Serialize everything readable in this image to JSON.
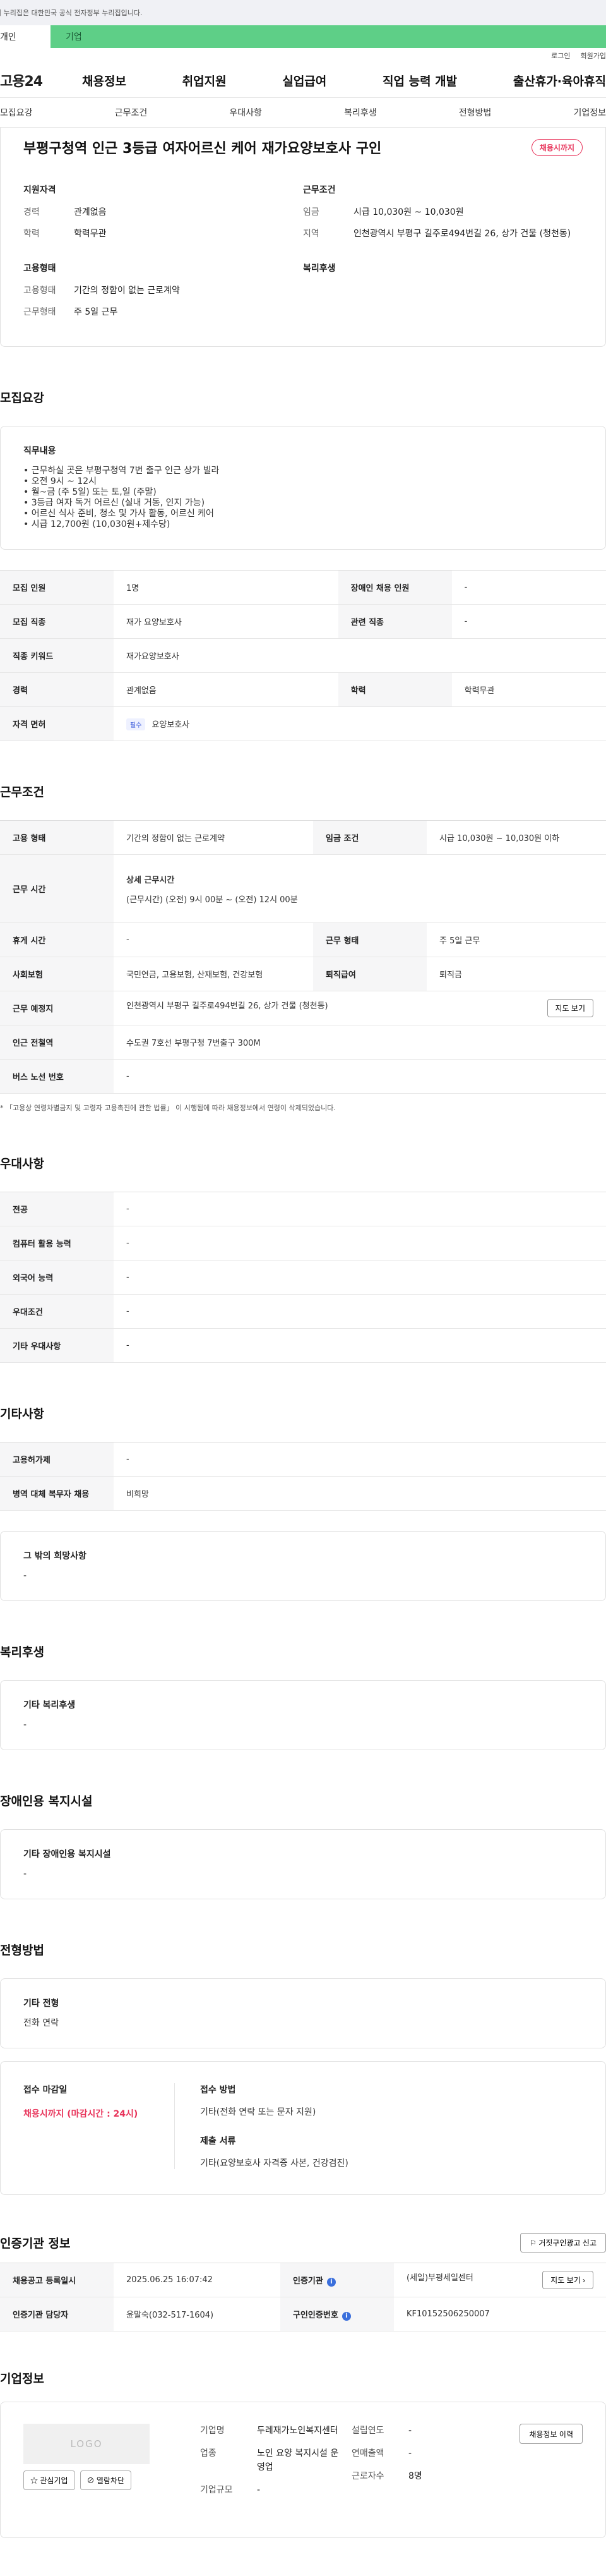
{
  "gov_banner": "이 누리집은 대한민국 공식 전자정부 누리집입니다.",
  "user_tabs": {
    "person": "개인",
    "business": "기업"
  },
  "util_links": [
    "로그인",
    "회원가입"
  ],
  "logo": "고용24",
  "gnb": [
    "채용정보",
    "취업지원",
    "실업급여",
    "직업 능력 개발",
    "출산휴가·육아휴직"
  ],
  "anchor_tabs": [
    "모집요강",
    "근무조건",
    "우대사항",
    "복리후생",
    "전형방법",
    "기업정보"
  ],
  "hero": {
    "title": "부평구청역 인근 3등급 여자어르신 케어 재가요양보호사 구인",
    "status": "채용시까지",
    "qual_title": "지원자격",
    "cond_title": "근무조건",
    "emp_title": "고용형태",
    "welfare_title": "복리후생",
    "qual": [
      {
        "k": "경력",
        "v": "관계없음"
      },
      {
        "k": "학력",
        "v": "학력무관"
      }
    ],
    "cond": [
      {
        "k": "임금",
        "v": "시급 10,030원 ~ 10,030원"
      },
      {
        "k": "지역",
        "v": "인천광역시 부평구 길주로494번길 26, 상가 건물 (청천동)"
      }
    ],
    "emp": [
      {
        "k": "고용형태",
        "v": "기간의 정함이 없는 근로계약"
      },
      {
        "k": "근무형태",
        "v": "주 5일 근무"
      }
    ]
  },
  "recruit": {
    "title": "모집요강",
    "duty_title": "직무내용",
    "duty_text": "• 근무하실 곳은 부평구청역 7번 출구 인근 상가 빌라\n• 오전 9시 ~ 12시\n• 월~금 (주 5일) 또는 토,일 (주말)\n• 3등급 여자 독거 어르신 (실내 거동, 인지 가능)\n• 어르신 식사 준비, 청소 및 가사 활동, 어르신 케어\n• 시급 12,700원 (10,030원+제수당)",
    "rows": [
      {
        "k1": "모집 인원",
        "v1": "1명",
        "k2": "장애인 채용 인원",
        "v2": "-"
      },
      {
        "k1": "모집 직종",
        "v1": "재가 요양보호사",
        "k2": "관련 직종",
        "v2": "-"
      },
      {
        "k1": "직종 키워드",
        "v1": "재가요양보호사"
      },
      {
        "k1": "경력",
        "v1": "관계없음",
        "k2": "학력",
        "v2": "학력무관"
      }
    ],
    "license_label": "자격 면허",
    "license_tag": "필수",
    "license_value": "요양보호사"
  },
  "work": {
    "title": "근무조건",
    "emp_type_k": "고용 형태",
    "emp_type_v": "기간의 정함이 없는 근로계약",
    "wage_k": "임금 조건",
    "wage_v": "시급 10,030원 ~ 10,030원 이하",
    "time_k": "근무 시간",
    "time_h": "상세 근무시간",
    "time_v": "(근무시간) (오전) 9시 00분 ~ (오전) 12시 00분",
    "rest_k": "휴게 시간",
    "rest_v": "-",
    "form_k": "근무 형태",
    "form_v": "주 5일 근무",
    "ins_k": "사회보험",
    "ins_v": "국민연금, 고용보험, 산재보험, 건강보험",
    "sev_k": "퇴직급여",
    "sev_v": "퇴직금",
    "place_k": "근무 예정지",
    "place_v": "인천광역시 부평구 길주로494번길 26, 상가 건물 (청천동)",
    "map_btn": "지도 보기",
    "station_k": "인근 전철역",
    "station_v": "수도권 7호선 부평구청 7번출구 300M",
    "bus_k": "버스 노선 번호",
    "bus_v": "-",
    "note": "* 「고용상 연령차별금지 및 고령자 고용촉진에 관한 법률」 이 시행됨에 따라 채용정보에서 연령이 삭제되었습니다."
  },
  "pref": {
    "title": "우대사항",
    "rows": [
      {
        "k": "전공",
        "v": "-"
      },
      {
        "k": "컴퓨터 활용 능력",
        "v": "-"
      },
      {
        "k": "외국어 능력",
        "v": "-"
      },
      {
        "k": "우대조건",
        "v": "-"
      },
      {
        "k": "기타 우대사항",
        "v": "-"
      }
    ]
  },
  "etc": {
    "title": "기타사항",
    "rows": [
      {
        "k": "고용허가제",
        "v": "-"
      },
      {
        "k": "병역 대체 복무자 채용",
        "v": "비희망"
      }
    ],
    "hope_title": "그 밖의 희망사항",
    "hope_v": "-"
  },
  "welfare": {
    "title": "복리후생",
    "box_title": "기타 복리후생",
    "box_v": "-"
  },
  "disabled": {
    "title": "장애인용 복지시설",
    "box_title": "기타 장애인용 복지시설",
    "box_v": "-"
  },
  "process": {
    "title": "전형방법",
    "box_title": "기타 전형",
    "box_v": "전화 연락",
    "deadline_h": "접수 마감일",
    "deadline_v": "채용시까지 (마감시간 : 24시)",
    "method_h": "접수 방법",
    "method_v": "기타(전화 연락 또는 문자 지원)",
    "docs_h": "제출 서류",
    "docs_v": "기타(요양보호사 자격증 사본, 건강검진)"
  },
  "cert": {
    "title": "인증기관 정보",
    "report_btn": "거짓구인광고 신고",
    "reg_k": "채용공고 등록일시",
    "reg_v": "2025.06.25 16:07:42",
    "org_k": "인증기관",
    "org_v": "(세일)부평세일센터",
    "map_btn": "지도 보기",
    "mgr_k": "인증기관 담당자",
    "mgr_v": "윤말숙(032-517-1604)",
    "no_k": "구인인증번호",
    "no_v": "KF10152506250007"
  },
  "company": {
    "title": "기업정보",
    "logo": "LOGO",
    "fav_btn": "관심기업",
    "block_btn": "열람차단",
    "name_k": "기업명",
    "name_v": "두레재가노인복지센터",
    "year_k": "설립연도",
    "year_v": "-",
    "ind_k": "업종",
    "ind_v": "노인 요양 복지시설 운영업",
    "sales_k": "연매출액",
    "sales_v": "-",
    "emp_k": "근로자수",
    "emp_v": "8명",
    "size_k": "기업규모",
    "size_v": "-",
    "recruit_btn": "채용정보 이력"
  }
}
